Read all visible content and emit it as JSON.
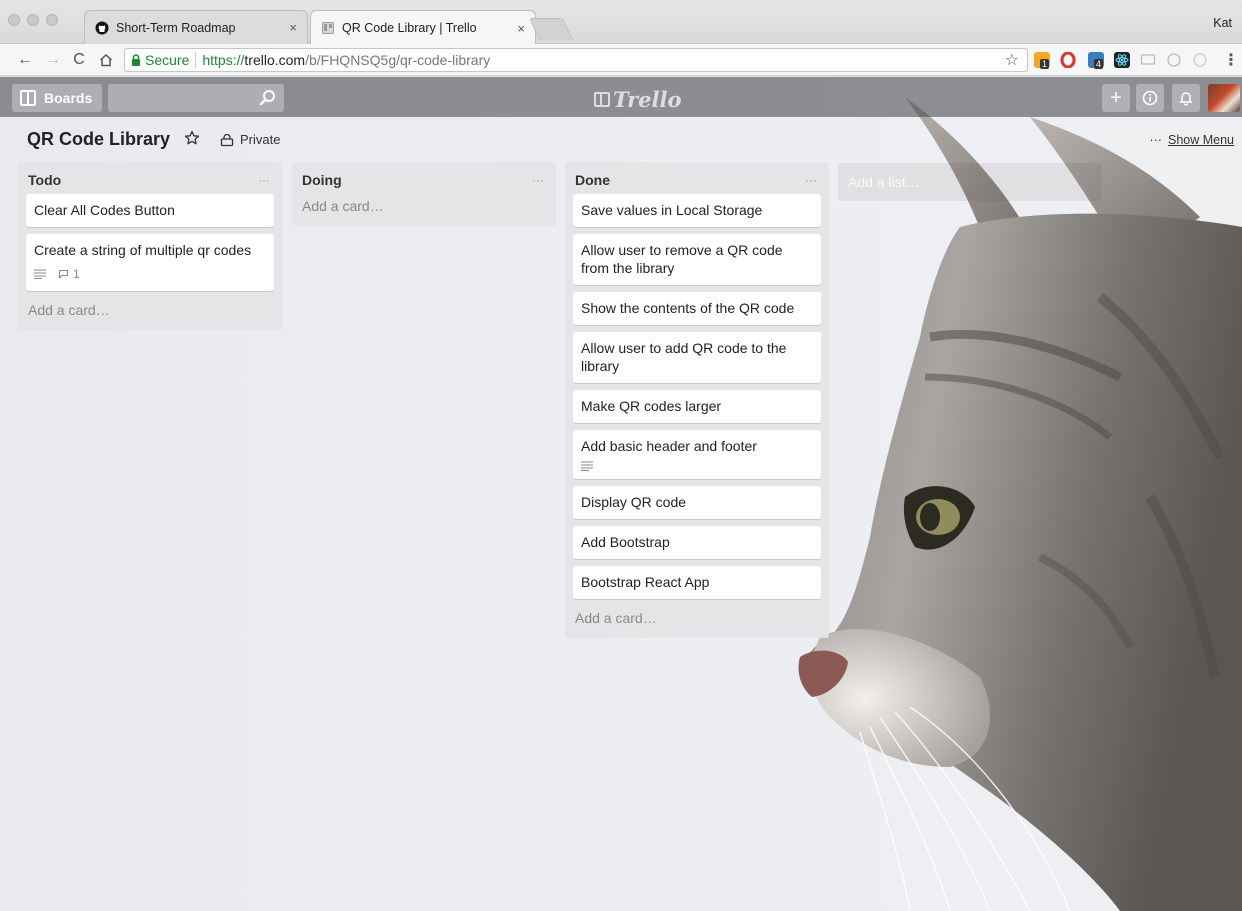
{
  "browser": {
    "tabs": [
      {
        "title": "Short-Term Roadmap",
        "icon": "github-icon",
        "active": false
      },
      {
        "title": "QR Code Library | Trello",
        "icon": "trello-icon",
        "active": true
      }
    ],
    "profile": "Kat",
    "url": {
      "secure_label": "Secure",
      "scheme": "https://",
      "host": "trello.com",
      "path": "/b/FHQNSQ5g/qr-code-library"
    },
    "extensions": [
      {
        "name": "calendar-extension-icon",
        "color": "#f5a623",
        "badge": "1"
      },
      {
        "name": "opera-icon",
        "color": "#e0322d"
      },
      {
        "name": "lastpass-icon",
        "color": "#3b7dc4",
        "badge": "4"
      },
      {
        "name": "react-devtools-icon",
        "color": "#222222"
      },
      {
        "name": "cast-icon",
        "color": "#bbbbbb"
      },
      {
        "name": "adblock-icon",
        "color": "#bbbbbb"
      },
      {
        "name": "clock-icon",
        "color": "#cccccc"
      }
    ]
  },
  "header": {
    "boards_label": "Boards",
    "search_value": "",
    "logo_text": "Trello"
  },
  "board": {
    "title": "QR Code Library",
    "privacy": "Private",
    "menu_dots": "···",
    "show_menu": "Show Menu",
    "add_list": "Add a list…",
    "add_card": "Add a card…",
    "lists": [
      {
        "title": "Todo",
        "cards": [
          {
            "text": "Clear All Codes Button"
          },
          {
            "text": "Create a string of multiple qr codes",
            "has_description": true,
            "comments": "1"
          }
        ]
      },
      {
        "title": "Doing",
        "cards": []
      },
      {
        "title": "Done",
        "cards": [
          {
            "text": "Save values in Local Storage"
          },
          {
            "text": "Allow user to remove a QR code from the library"
          },
          {
            "text": "Show the contents of the QR code"
          },
          {
            "text": "Allow user to add QR code to the library"
          },
          {
            "text": "Make QR codes larger"
          },
          {
            "text": "Add basic header and footer",
            "has_description": true
          },
          {
            "text": "Display QR code"
          },
          {
            "text": "Add Bootstrap"
          },
          {
            "text": "Bootstrap React App"
          }
        ]
      }
    ]
  },
  "colors": {
    "secure_green": "#1b8a2d",
    "list_bg": "#e2e4e6",
    "card_bg": "#ffffff"
  }
}
